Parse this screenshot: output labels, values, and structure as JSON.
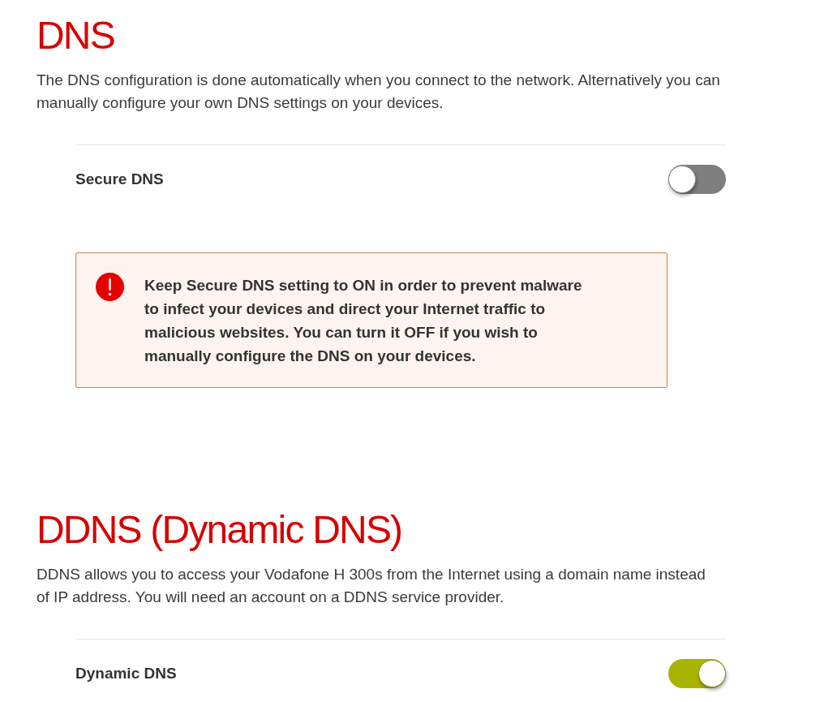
{
  "sections": [
    {
      "title": "DNS",
      "description_lines": [
        "The DNS configuration is done automatically when you connect to the network. Alternatively you can",
        "manually configure your own DNS settings on your devices."
      ],
      "settings": [
        {
          "label": "Secure DNS",
          "on": false
        }
      ],
      "alert": {
        "text_lines": [
          "Keep Secure DNS setting to ON in order to prevent malware",
          "to infect your devices and direct your Internet traffic to",
          "malicious websites. You can turn it OFF if you wish to",
          "manually configure the DNS on your devices."
        ]
      }
    },
    {
      "title": "DDNS (Dynamic DNS)",
      "description_lines": [
        "DDNS allows you to access your Vodafone H 300s from the Internet using a domain name instead",
        "of IP address. You will need an account on a DDNS service provider."
      ],
      "settings": [
        {
          "label": "Dynamic DNS",
          "on": true
        }
      ]
    }
  ]
}
